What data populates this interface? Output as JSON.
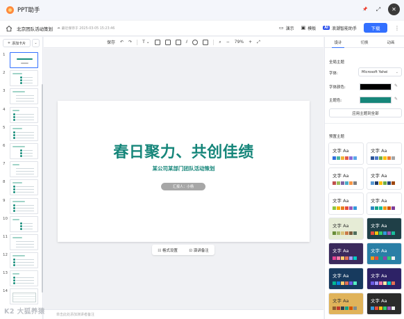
{
  "app": {
    "title": "PPT助手"
  },
  "window_controls": {
    "pin": "📌",
    "fullscreen": "⤢",
    "close": "✕"
  },
  "doc": {
    "title": "北京团队活动策划",
    "saved_text": "最近保存于 2025-03-05 15:23:46",
    "present_label": "演示",
    "template_label": "模板",
    "ai_badge": "AI",
    "ai_label": "浪潮智能助手",
    "download_label": "下载"
  },
  "slide_panel": {
    "add_card_label": "添加卡片",
    "slide_numbers": [
      "1",
      "2",
      "3",
      "4",
      "5",
      "6",
      "7",
      "8",
      "9",
      "10",
      "11",
      "12",
      "13",
      "14"
    ]
  },
  "edit_toolbar": {
    "save_label": "保存",
    "zoom": "79%"
  },
  "slide": {
    "title": "春日聚力、共创佳绩",
    "subtitle": "某公司某部门团队活动策划",
    "reporter": "汇报人：小杨",
    "format_label": "格式设置",
    "notes_label": "演讲备注"
  },
  "notes_placeholder": "单击此处添加演讲者备注",
  "watermark": "K2 大狐养猿",
  "right_panel": {
    "tabs": [
      "设计",
      "切换",
      "动画"
    ],
    "global_theme_title": "全局主题",
    "font_label": "字体:",
    "font_value": "Microsoft Yahei",
    "font_color_label": "字体颜色:",
    "theme_color_label": "主题色:",
    "apply_all_label": "应用主题到全部",
    "preset_title": "预置主题",
    "font_color": "#000000",
    "theme_color": "#16867a",
    "themes": [
      {
        "label": "文字 Aa",
        "bg": "#ffffff",
        "fg": "#333333",
        "swatches": [
          "#2f6fde",
          "#47b6a1",
          "#f0b23a",
          "#e45b4a",
          "#8b6bd6",
          "#5aa6e8"
        ]
      },
      {
        "label": "文字 Aa",
        "bg": "#ffffff",
        "fg": "#333333",
        "swatches": [
          "#2f5597",
          "#4c7ac9",
          "#70ad47",
          "#ffc000",
          "#ed7d31",
          "#a5a5a5"
        ]
      },
      {
        "label": "文字 Aa",
        "bg": "#ffffff",
        "fg": "#333333",
        "swatches": [
          "#c0504d",
          "#9bbb59",
          "#8064a2",
          "#4bacc6",
          "#f79646",
          "#7f7f7f"
        ]
      },
      {
        "label": "文字 Aa",
        "bg": "#ffffff",
        "fg": "#333333",
        "swatches": [
          "#5b9bd5",
          "#1f3864",
          "#ffc000",
          "#70ad47",
          "#264478",
          "#9e480e"
        ]
      },
      {
        "label": "文字 Aa",
        "bg": "#ffffff",
        "fg": "#333333",
        "swatches": [
          "#8dc63f",
          "#f4b400",
          "#e67e22",
          "#e74c3c",
          "#9b59b6",
          "#3498db"
        ]
      },
      {
        "label": "文字 Aa",
        "bg": "#ffffff",
        "fg": "#333333",
        "swatches": [
          "#2e86c1",
          "#17a589",
          "#1abc9c",
          "#f39c12",
          "#d35400",
          "#7d3c98"
        ]
      },
      {
        "label": "文字 Aa",
        "bg": "#e6ecd6",
        "fg": "#333333",
        "swatches": [
          "#6a8e3a",
          "#a3b86c",
          "#d9c27a",
          "#c97b4a",
          "#7a5c3e",
          "#4e6e5d"
        ]
      },
      {
        "label": "文字 Aa",
        "bg": "#1f3f47",
        "fg": "#ffffff",
        "swatches": [
          "#e74c3c",
          "#f1c40f",
          "#2ecc71",
          "#3498db",
          "#9b59b6",
          "#1abc9c"
        ]
      },
      {
        "label": "文字 Aa",
        "bg": "#3b2a5c",
        "fg": "#ffffff",
        "swatches": [
          "#e84393",
          "#fd79a8",
          "#fdcb6e",
          "#e17055",
          "#a29bfe",
          "#00cec9"
        ]
      },
      {
        "label": "文字 Aa",
        "bg": "#2a7fa6",
        "fg": "#ffffff",
        "swatches": [
          "#f39c12",
          "#e74c3c",
          "#16a085",
          "#8e44ad",
          "#2ecc71",
          "#ecf0f1"
        ]
      },
      {
        "label": "文字 Aa",
        "bg": "#173a5e",
        "fg": "#ffffff",
        "swatches": [
          "#00b894",
          "#0984e3",
          "#fdcb6e",
          "#e17055",
          "#6c5ce7",
          "#55efc4"
        ]
      },
      {
        "label": "文字 Aa",
        "bg": "#2d2266",
        "fg": "#ffffff",
        "swatches": [
          "#6c5ce7",
          "#a29bfe",
          "#fd79a8",
          "#ffeaa7",
          "#00cec9",
          "#e17055"
        ]
      },
      {
        "label": "文字 Aa",
        "bg": "#e0b35a",
        "fg": "#333333",
        "swatches": [
          "#8e5b2f",
          "#c0392b",
          "#2c3e50",
          "#16a085",
          "#d35400",
          "#7f8c8d"
        ]
      },
      {
        "label": "文字 Aa",
        "bg": "#2b2b2b",
        "fg": "#ffffff",
        "swatches": [
          "#3498db",
          "#e74c3c",
          "#f1c40f",
          "#2ecc71",
          "#9b59b6",
          "#ecf0f1"
        ]
      }
    ]
  }
}
